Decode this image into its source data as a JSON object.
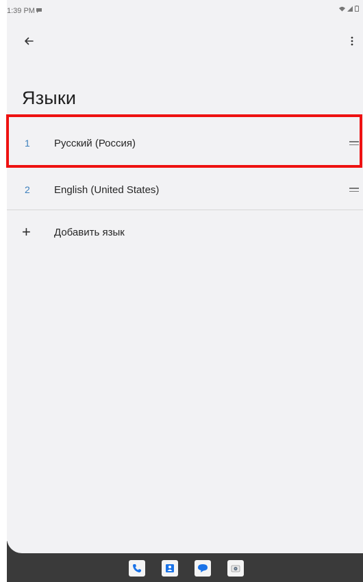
{
  "status_bar": {
    "time": "1:39 PM",
    "icons": [
      "notification-icon",
      "wifi-icon",
      "signal-icon",
      "battery-icon"
    ]
  },
  "toolbar": {
    "back_icon": "arrow-back-icon",
    "more_icon": "more-vert-icon"
  },
  "page": {
    "title": "Языки"
  },
  "languages": [
    {
      "number": "1",
      "name": "Русский (Россия)",
      "handle_icon": "drag-handle-icon"
    },
    {
      "number": "2",
      "name": "English (United States)",
      "handle_icon": "drag-handle-icon"
    }
  ],
  "add_language": {
    "icon": "plus-icon",
    "label": "Добавить язык"
  },
  "dock": {
    "apps": [
      "phone-icon",
      "contacts-icon",
      "messages-icon",
      "camera-icon"
    ]
  },
  "colors": {
    "accent": "#3c7fbc",
    "highlight": "#ee1111",
    "dock_app_blue": "#1a73e8"
  }
}
